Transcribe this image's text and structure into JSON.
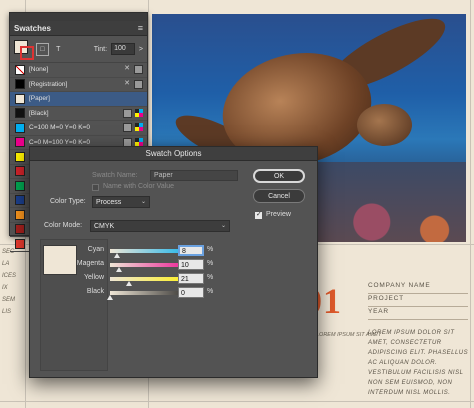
{
  "document": {
    "big_number": "01",
    "company_fields": [
      "COMPANY NAME",
      "PROJECT",
      "YEAR"
    ],
    "lorem_right": "LOREM IPSUM DOLOR SIT AMET, CONSECTETUR ADIPISCING ELIT. PHASELLUS AC ALIQUAN DOLOR. VESTIBULUM FACILISIS NISL NON SEM EUISMOD, NON INTERDUM NISL MOLLIS.",
    "under_number": "LOREM IPSUM SIT AMET",
    "left_column": [
      "SEC",
      "LA",
      "ICES",
      "IX",
      "SEM",
      "LIS"
    ]
  },
  "swatches_panel": {
    "title": "Swatches",
    "menu_icon": "hamburger-menu-icon",
    "tint_label": "Tint:",
    "tint_value": "100",
    "tint_unit": ">",
    "rows": [
      {
        "name": "[None]",
        "color": "#ffffff",
        "icon": "none"
      },
      {
        "name": "[Registration]",
        "color": "#000000",
        "icon": "registration"
      },
      {
        "name": "[Paper]",
        "color": "#efe6d6",
        "icon": "",
        "selected": true
      },
      {
        "name": "[Black]",
        "color": "#111111",
        "icon": "cmyk"
      },
      {
        "name": "C=100 M=0 Y=0 K=0",
        "color": "#00aeef",
        "icon": "cmyk"
      },
      {
        "name": "C=0 M=100 Y=0 K=0",
        "color": "#ec008c",
        "icon": "cmyk"
      },
      {
        "name": "C=0 M=0 Y=100 K=0",
        "color": "#fff200",
        "icon": "cmyk"
      },
      {
        "name": "",
        "color": "#d2232a",
        "icon": ""
      },
      {
        "name": "",
        "color": "#00a651",
        "icon": ""
      },
      {
        "name": "",
        "color": "#1b3f8b",
        "icon": ""
      },
      {
        "name": "",
        "color": "#f7941d",
        "icon": ""
      },
      {
        "name": "",
        "color": "#a4201d",
        "icon": ""
      },
      {
        "name": "",
        "color": "#e73a2e",
        "icon": ""
      }
    ]
  },
  "dialog": {
    "title": "Swatch Options",
    "swatch_name_label": "Swatch Name:",
    "swatch_name_value": "Paper",
    "name_with_color_value": "Name with Color Value",
    "color_type_label": "Color Type:",
    "color_type_value": "Process",
    "color_mode_label": "Color Mode:",
    "color_mode_value": "CMYK",
    "ok": "OK",
    "cancel": "Cancel",
    "preview": "Preview",
    "preview_checked": true,
    "pct": "%",
    "channels": [
      {
        "name": "Cyan",
        "value": 8,
        "display": "8"
      },
      {
        "name": "Magenta",
        "value": 10,
        "display": "10"
      },
      {
        "name": "Yellow",
        "value": 21,
        "display": "21"
      },
      {
        "name": "Black",
        "value": 0,
        "display": "0"
      }
    ]
  }
}
